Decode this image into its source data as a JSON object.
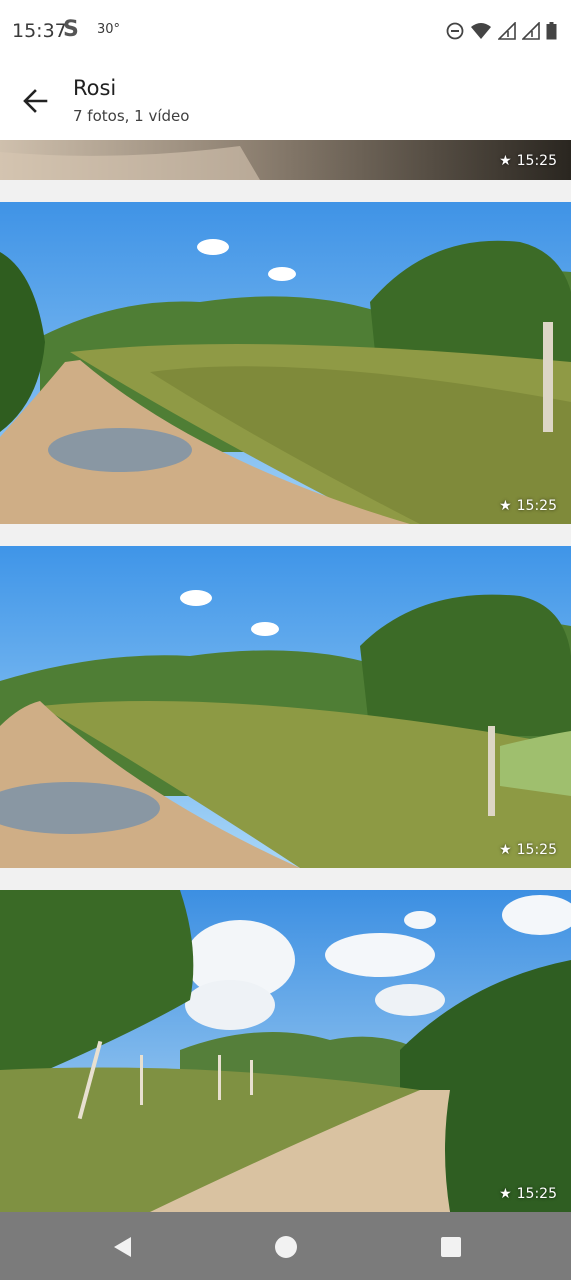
{
  "status_bar": {
    "time": "15:37",
    "app_glyph": "S",
    "temperature": "30°",
    "icons": [
      "do-not-disturb-icon",
      "wifi-icon",
      "signal-icon",
      "signal-icon",
      "battery-icon"
    ]
  },
  "header": {
    "back_icon": "arrow-back-icon",
    "title": "Rosi",
    "subtitle": "7 fotos, 1 vídeo"
  },
  "gallery": {
    "items": [
      {
        "time": "15:25",
        "icon": "star-icon"
      },
      {
        "time": "15:25",
        "icon": "star-icon"
      },
      {
        "time": "15:25",
        "icon": "star-icon"
      },
      {
        "time": "15:25",
        "icon": "star-icon"
      }
    ]
  },
  "nav_bar": {
    "buttons": [
      "back-triangle-icon",
      "home-circle-icon",
      "recents-square-icon"
    ]
  },
  "colors": {
    "nav_bar": "#7b7b7b",
    "sky": "#4f9fe8",
    "foliage": "#3f6f2a",
    "road": "#c9ac8a"
  }
}
